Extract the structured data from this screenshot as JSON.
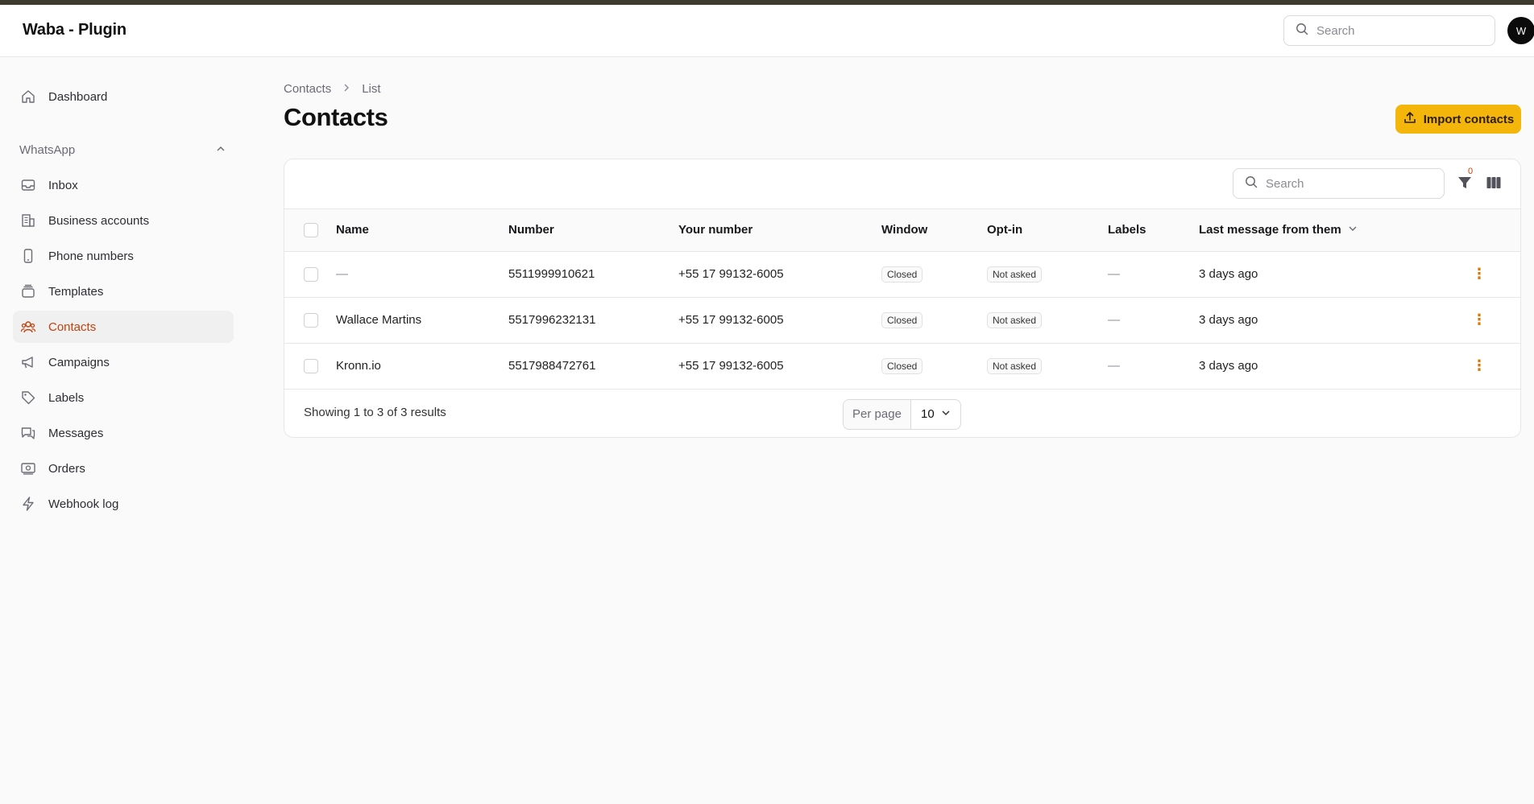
{
  "app": {
    "title": "Waba - Plugin",
    "avatar_initial": "W"
  },
  "topbar": {
    "search_placeholder": "Search"
  },
  "sidebar": {
    "dashboard": "Dashboard",
    "group_label": "WhatsApp",
    "items": [
      {
        "label": "Inbox",
        "icon": "inbox-icon"
      },
      {
        "label": "Business accounts",
        "icon": "building-icon"
      },
      {
        "label": "Phone numbers",
        "icon": "phone-icon"
      },
      {
        "label": "Templates",
        "icon": "template-icon"
      },
      {
        "label": "Contacts",
        "icon": "users-icon",
        "active": true
      },
      {
        "label": "Campaigns",
        "icon": "megaphone-icon"
      },
      {
        "label": "Labels",
        "icon": "tag-icon"
      },
      {
        "label": "Messages",
        "icon": "chat-icon"
      },
      {
        "label": "Orders",
        "icon": "cash-icon"
      },
      {
        "label": "Webhook log",
        "icon": "bolt-icon"
      }
    ]
  },
  "breadcrumb": {
    "parent": "Contacts",
    "current": "List"
  },
  "page": {
    "title": "Contacts",
    "import_button": "Import contacts"
  },
  "table": {
    "search_placeholder": "Search",
    "filter_count": "0",
    "columns": {
      "name": "Name",
      "number": "Number",
      "your_number": "Your number",
      "window": "Window",
      "optin": "Opt-in",
      "labels": "Labels",
      "last_message": "Last message from them"
    },
    "rows": [
      {
        "name": "—",
        "number": "5511999910621",
        "your_number": "+55 17 99132-6005",
        "window": "Closed",
        "optin": "Not asked",
        "labels": "—",
        "last_message": "3 days ago"
      },
      {
        "name": "Wallace Martins",
        "number": "5517996232131",
        "your_number": "+55 17 99132-6005",
        "window": "Closed",
        "optin": "Not asked",
        "labels": "—",
        "last_message": "3 days ago"
      },
      {
        "name": "Kronn.io",
        "number": "5517988472761",
        "your_number": "+55 17 99132-6005",
        "window": "Closed",
        "optin": "Not asked",
        "labels": "—",
        "last_message": "3 days ago"
      }
    ],
    "footer": {
      "results_text": "Showing 1 to 3 of 3 results",
      "per_page_label": "Per page",
      "per_page_value": "10"
    }
  },
  "colors": {
    "accent": "#c2410c",
    "button": "#f5b60c",
    "kebab": "#d97706"
  }
}
